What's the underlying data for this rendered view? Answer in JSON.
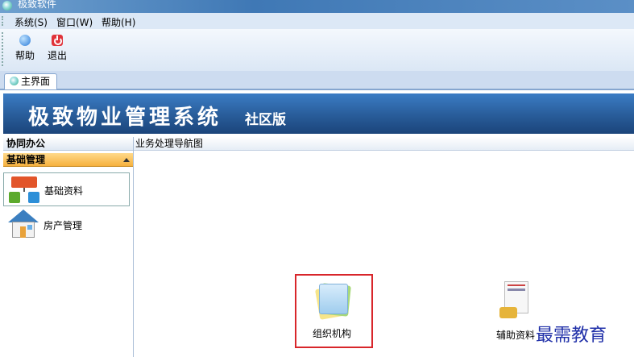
{
  "window": {
    "title": "极致软件"
  },
  "menu": {
    "items": [
      "系统(S)",
      "窗口(W)",
      "帮助(H)"
    ]
  },
  "toolbar": {
    "help_label": "帮助",
    "exit_label": "退出"
  },
  "tabs": [
    {
      "label": "主界面",
      "active": true
    }
  ],
  "banner": {
    "system_name": "极致物业管理系统",
    "edition": "社区版"
  },
  "sidebar": {
    "groups": [
      {
        "label": "协同办公",
        "expanded": false
      },
      {
        "label": "基础管理",
        "expanded": true
      }
    ],
    "items": [
      {
        "label": "基础资料",
        "icon": "org-chart-icon",
        "selected": true
      },
      {
        "label": "房产管理",
        "icon": "house-icon",
        "selected": false
      }
    ]
  },
  "main": {
    "header": "业务处理导航图",
    "tiles": [
      {
        "label": "组织机构",
        "icon": "document-stack-icon",
        "highlighted": true
      },
      {
        "label": "辅助资料",
        "icon": "report-icon",
        "highlighted": false
      }
    ]
  },
  "watermark": "最需教育"
}
